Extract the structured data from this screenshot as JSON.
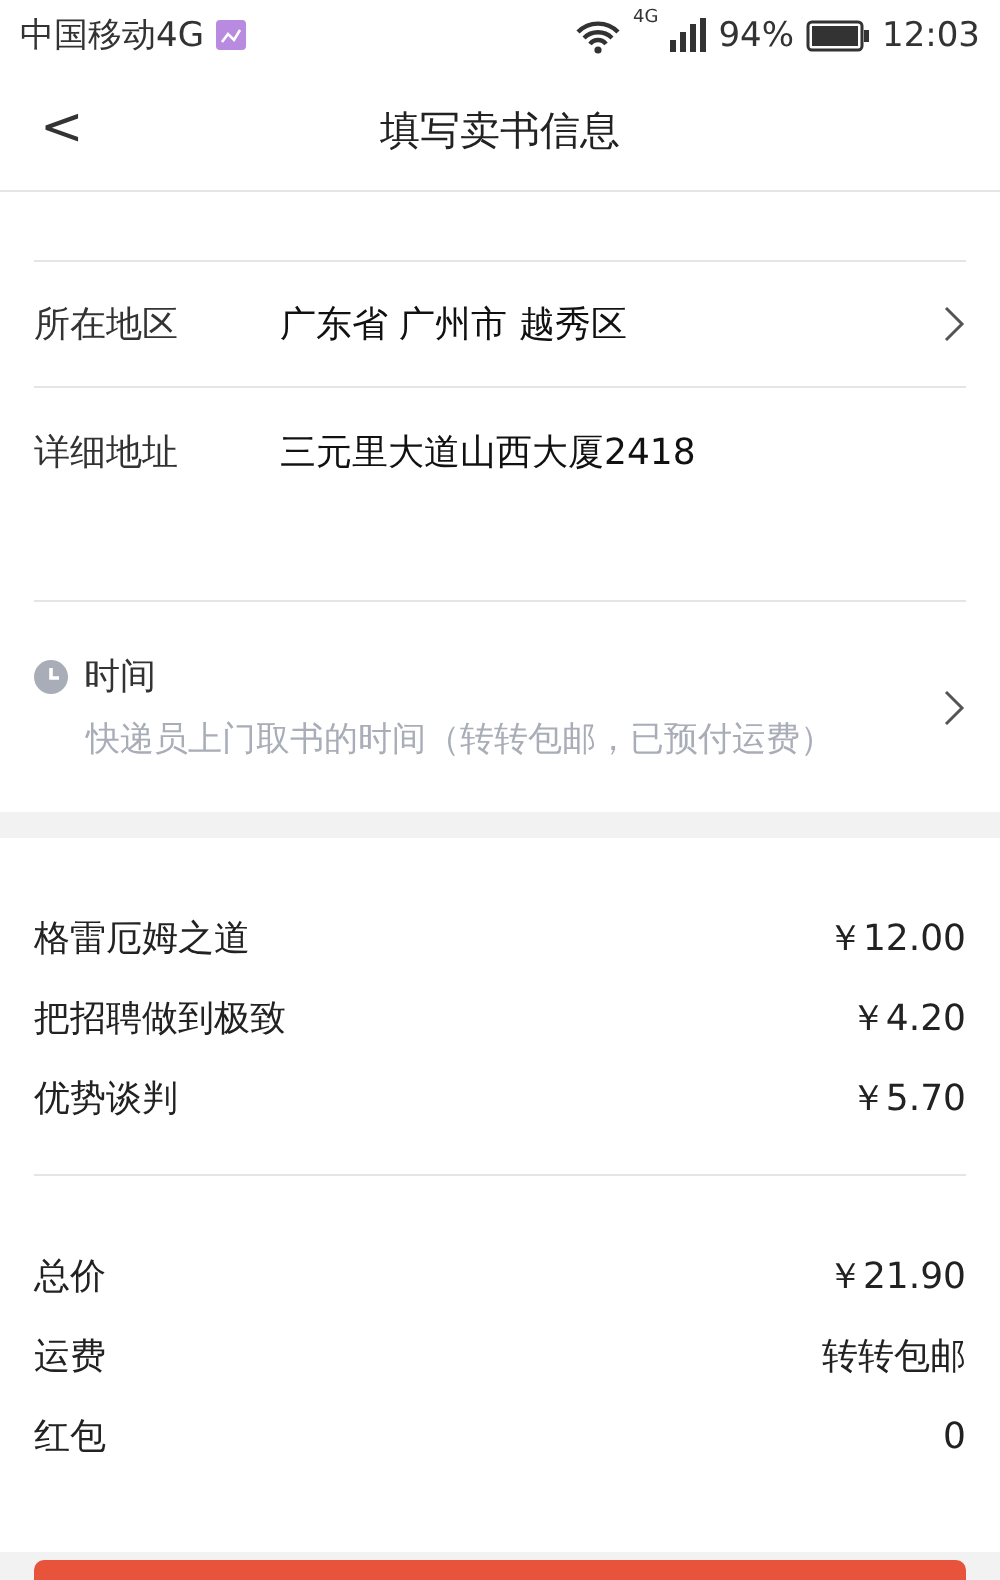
{
  "status_bar": {
    "carrier": "中国移动4G",
    "signal_label": "4G",
    "battery": "94%",
    "time": "12:03"
  },
  "header": {
    "back": "<",
    "title": "填写卖书信息"
  },
  "address": [
    {
      "label": "所在地区",
      "value": "广东省 广州市 越秀区",
      "arrow": true
    },
    {
      "label": "详细地址",
      "value": "三元里大道山西大厦2418",
      "arrow": false
    }
  ],
  "pickup": {
    "title": "时间",
    "hint": "快递员上门取书的时间（转转包邮，已预付运费）"
  },
  "books": [
    {
      "name": "格雷厄姆之道",
      "price": "￥12.00"
    },
    {
      "name": "把招聘做到极致",
      "price": "￥4.20"
    },
    {
      "name": "优势谈判",
      "price": "￥5.70"
    }
  ],
  "summary": [
    {
      "label": "总价",
      "value": "￥21.90"
    },
    {
      "label": "运费",
      "value": "转转包邮"
    },
    {
      "label": "红包",
      "value": "0"
    }
  ]
}
